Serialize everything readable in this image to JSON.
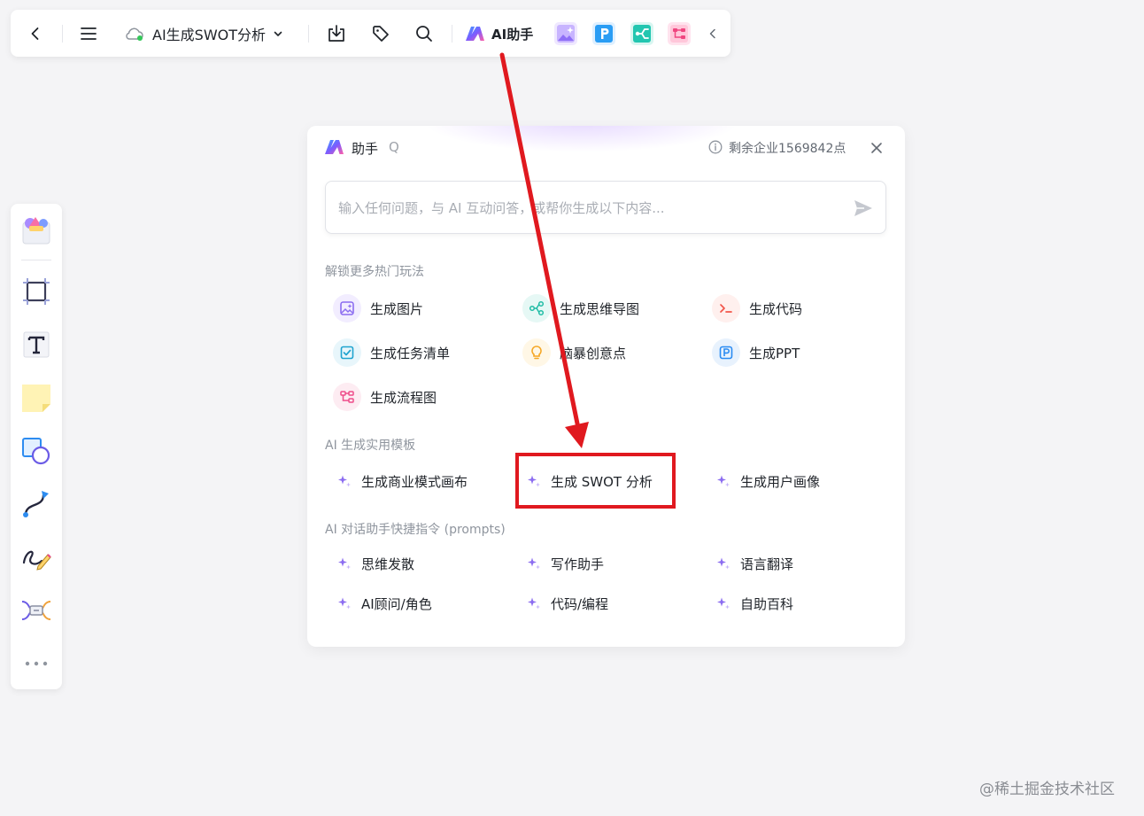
{
  "topbar": {
    "doc_title": "AI生成SWOT分析",
    "ai_label": "AI助手"
  },
  "panel": {
    "title": "助手",
    "q_label": "Q",
    "points": "剩余企业1569842点",
    "input_placeholder": "输入任何问题，与 AI 互动问答，或帮你生成以下内容...",
    "section1_title": "解锁更多热门玩法",
    "features": [
      {
        "label": "生成图片",
        "icon": "image-icon"
      },
      {
        "label": "生成思维导图",
        "icon": "mindmap-icon"
      },
      {
        "label": "生成代码",
        "icon": "code-icon"
      },
      {
        "label": "生成任务清单",
        "icon": "checklist-icon"
      },
      {
        "label": "脑暴创意点",
        "icon": "lightbulb-icon"
      },
      {
        "label": "生成PPT",
        "icon": "ppt-icon"
      },
      {
        "label": "生成流程图",
        "icon": "flowchart-icon"
      }
    ],
    "section2_title": "AI 生成实用模板",
    "templates": [
      {
        "label": "生成商业模式画布"
      },
      {
        "label": "生成 SWOT 分析"
      },
      {
        "label": "生成用户画像"
      }
    ],
    "section3_title": "AI 对话助手快捷指令 (prompts)",
    "prompts": [
      {
        "label": "思维发散"
      },
      {
        "label": "写作助手"
      },
      {
        "label": "语言翻译"
      },
      {
        "label": "AI顾问/角色"
      },
      {
        "label": "代码/编程"
      },
      {
        "label": "自助百科"
      }
    ]
  },
  "watermark": "@稀土掘金技术社区",
  "colors": {
    "highlight": "#e0191f",
    "spark": "#8b6cf0",
    "accent_blue": "#2a8bf2"
  }
}
